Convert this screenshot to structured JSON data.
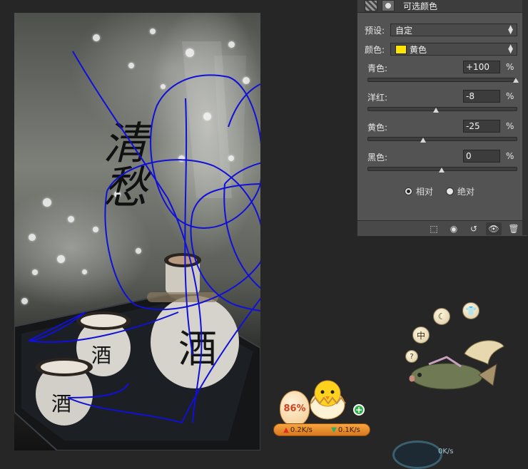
{
  "panel": {
    "title": "可选颜色",
    "preset_label": "预设:",
    "preset_value": "自定",
    "colors_label": "颜色:",
    "colors_value": "黄色",
    "swatch_color": "#ffe400",
    "sliders": [
      {
        "label": "青色:",
        "value": "+100",
        "unit": "%",
        "position": 1.0
      },
      {
        "label": "洋红:",
        "value": "-8",
        "unit": "%",
        "position": 0.46
      },
      {
        "label": "黄色:",
        "value": "-25",
        "unit": "%",
        "position": 0.375
      },
      {
        "label": "黑色:",
        "value": "0",
        "unit": "%",
        "position": 0.5
      }
    ],
    "method": {
      "relative_label": "相对",
      "absolute_label": "绝对",
      "selected": "relative"
    }
  },
  "canvas": {
    "calligraphy": "清愁",
    "jar_character": "酒",
    "cup_character": "酒"
  },
  "widgets": {
    "bubbles": [
      "中",
      "?"
    ],
    "net_percent": "86%",
    "upload_speed": "0.2K/s",
    "download_speed": "0.1K/s",
    "meter_speed": "0K/s"
  }
}
